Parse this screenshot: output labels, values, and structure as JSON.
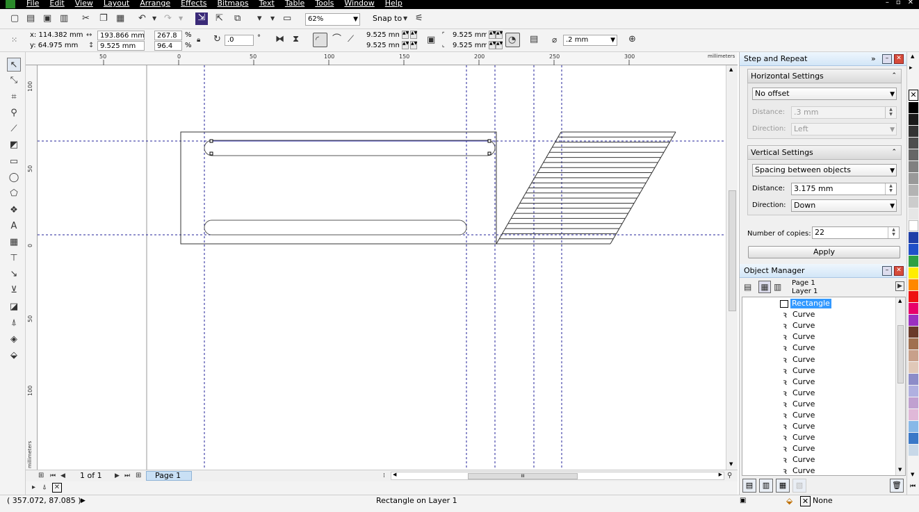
{
  "menu": {
    "items": [
      "File",
      "Edit",
      "View",
      "Layout",
      "Arrange",
      "Effects",
      "Bitmaps",
      "Text",
      "Table",
      "Tools",
      "Window",
      "Help"
    ]
  },
  "toolbar": {
    "zoom": "62%",
    "snap_to": "Snap to"
  },
  "property_bar": {
    "x": "x: 114.382 mm",
    "y": "y: 64.975 mm",
    "width": "193.866 mm",
    "height": "9.525 mm",
    "scale_w": "267.8",
    "scale_h": "96.4",
    "pct": "%",
    "rotation": ".0",
    "degree": "°",
    "corner_tl": "9.525 mm",
    "corner_bl": "9.525 mm",
    "corner_tr": "9.525 mm",
    "corner_br": "9.525 mm",
    "outline_width": ".2 mm"
  },
  "ruler": {
    "h_ticks": [
      "50",
      "0",
      "50",
      "100",
      "150",
      "200",
      "250",
      "300"
    ],
    "h_units": "millimeters",
    "v_ticks": [
      "100",
      "50",
      "0",
      "50",
      "100"
    ],
    "v_units": "millimeters"
  },
  "page_nav": {
    "page_count": "1 of 1",
    "page_tab": "Page 1",
    "hscroll_grip": "III"
  },
  "step_repeat": {
    "title": "Step and Repeat",
    "horizontal": {
      "heading": "Horizontal Settings",
      "mode": "No offset",
      "distance_label": "Distance:",
      "distance": ".3 mm",
      "direction_label": "Direction:",
      "direction": "Left"
    },
    "vertical": {
      "heading": "Vertical Settings",
      "mode": "Spacing between objects",
      "distance_label": "Distance:",
      "distance": "3.175 mm",
      "direction_label": "Direction:",
      "direction": "Down"
    },
    "copies_label": "Number of copies:",
    "copies": "22",
    "apply": "Apply"
  },
  "object_manager": {
    "title": "Object Manager",
    "page": "Page 1",
    "layer": "Layer 1",
    "selected": "Rectangle",
    "items": [
      "Curve",
      "Curve",
      "Curve",
      "Curve",
      "Curve",
      "Curve",
      "Curve",
      "Curve",
      "Curve",
      "Curve",
      "Curve",
      "Curve",
      "Curve",
      "Curve",
      "Curve"
    ]
  },
  "palette": {
    "colors": [
      "#000000",
      "#1a1a1a",
      "#333333",
      "#4d4d4d",
      "#666666",
      "#808080",
      "#999999",
      "#b3b3b3",
      "#cccccc",
      "#e6e6e6",
      "#ffffff",
      "#1f3fa8",
      "#2050c8",
      "#2ea043",
      "#ffee00",
      "#ff8800",
      "#ee1111",
      "#e8006a",
      "#9b30c0",
      "#6a3a2a",
      "#a07050",
      "#c8a08a",
      "#e0c8b8",
      "#8c8cc8",
      "#b0b0e0",
      "#c0a0d0",
      "#e0b8d8",
      "#88b8e8",
      "#3a78c8",
      "#c8d8e8"
    ]
  },
  "status": {
    "coords": "( 357.072, 87.085 )",
    "object_info": "Rectangle on Layer 1",
    "outline": "None"
  }
}
